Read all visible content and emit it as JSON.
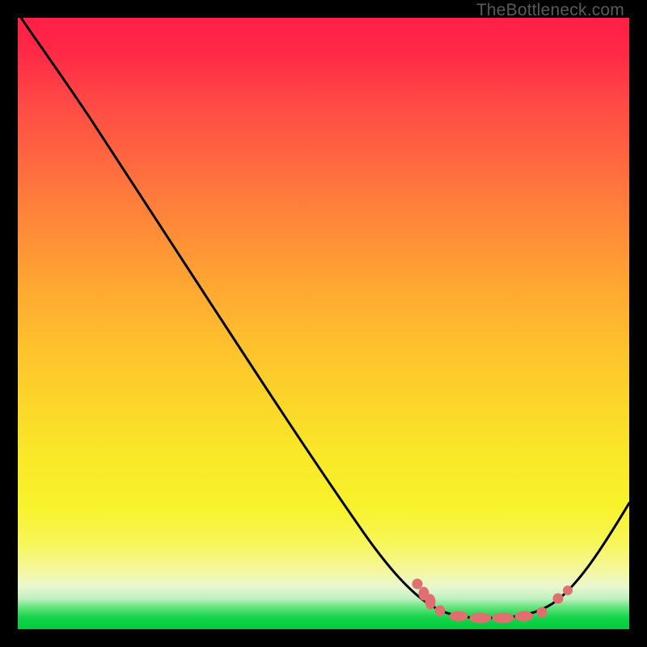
{
  "watermark": "TheBottleneck.com",
  "chart_data": {
    "type": "line",
    "title": "",
    "xlabel": "",
    "ylabel": "",
    "xlim": [
      0,
      100
    ],
    "ylim": [
      0,
      100
    ],
    "grid": false,
    "legend": false,
    "series": [
      {
        "name": "bottleneck-curve",
        "color": "#000000",
        "x": [
          0,
          5,
          10,
          15,
          20,
          25,
          30,
          35,
          40,
          45,
          50,
          55,
          60,
          63,
          66,
          69,
          72,
          77,
          82,
          85,
          88,
          91,
          94,
          97,
          100
        ],
        "y": [
          100,
          94,
          88,
          81,
          74,
          67,
          60,
          53,
          46,
          39,
          32,
          25,
          18,
          13,
          9,
          6,
          4,
          2.5,
          2,
          2.5,
          3.5,
          6,
          10,
          15,
          21
        ]
      },
      {
        "name": "data-points",
        "color": "#e07070",
        "style": "dots",
        "x": [
          65.5,
          67.5,
          70,
          73,
          76,
          79,
          82,
          84.5,
          87,
          89,
          90.5
        ],
        "y": [
          7.5,
          5.8,
          4.0,
          2.8,
          2.2,
          2.0,
          2.0,
          2.2,
          3.0,
          4.5,
          5.5
        ]
      }
    ],
    "annotations": []
  }
}
